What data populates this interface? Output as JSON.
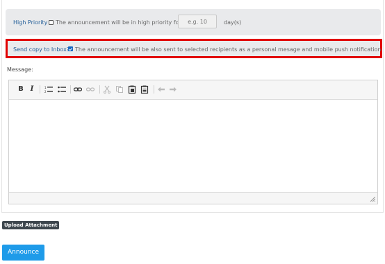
{
  "priority": {
    "label": "High Priority",
    "checked": false,
    "description": "The announcement will be in high priority for",
    "days_placeholder": "e.g. 10",
    "days_value": "",
    "days_unit": "day(s)"
  },
  "inbox": {
    "label": "Send copy to Inbox?",
    "checked": true,
    "description": "The announcement will be also sent to selected recipients as a personal mesage and mobile push notification"
  },
  "message": {
    "label": "Message:",
    "content": ""
  },
  "toolbar": {
    "bold": "B",
    "italic": "I",
    "numbered_list": "numbered-list-icon",
    "bulleted_list": "bulleted-list-icon",
    "link": "link-icon",
    "unlink": "unlink-icon",
    "cut": "cut-icon",
    "copy": "copy-icon",
    "paste": "paste-icon",
    "paste_text": "paste-text-icon",
    "undo": "undo-icon",
    "redo": "redo-icon"
  },
  "buttons": {
    "upload": "Upload Attachment",
    "announce": "Announce"
  },
  "colors": {
    "label_blue": "#1f5b96",
    "highlight_red": "#e10000",
    "primary_button": "#1e9be9",
    "dark_button": "#3d464d"
  }
}
